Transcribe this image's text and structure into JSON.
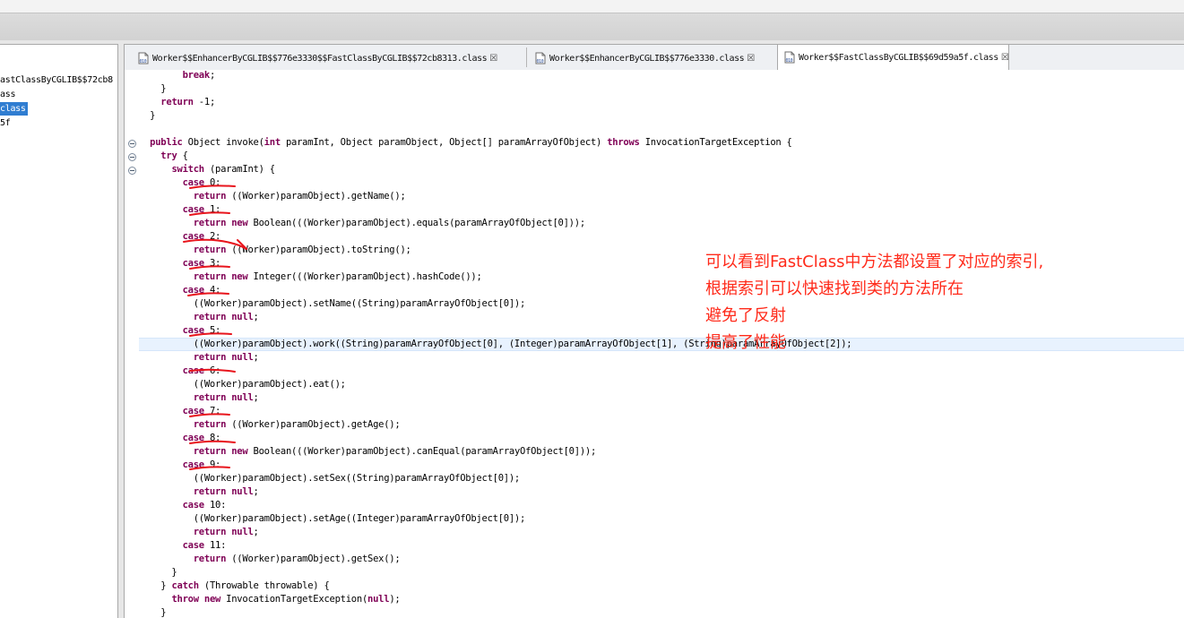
{
  "explorer": {
    "items": [
      {
        "label": "astClassByCGLIB$$72cb8",
        "selected": false
      },
      {
        "label": "ass",
        "selected": false
      },
      {
        "label": "class",
        "selected": true
      },
      {
        "label": "5f",
        "selected": false
      }
    ]
  },
  "editor_tabs": [
    {
      "label": "Worker$$EnhancerByCGLIB$$776e3330$$FastClassByCGLIB$$72cb8313.class",
      "close": "☒",
      "active": false
    },
    {
      "label": "Worker$$EnhancerByCGLIB$$776e3330.class",
      "close": "☒",
      "active": false
    },
    {
      "label": "Worker$$FastClassByCGLIB$$69d59a5f.class",
      "close": "☒",
      "active": true
    }
  ],
  "code_lines": [
    "        break;",
    "    }",
    "    return -1;",
    "  }",
    "",
    "  public Object invoke(int paramInt, Object paramObject, Object[] paramArrayOfObject) throws InvocationTargetException {",
    "    try {",
    "      switch (paramInt) {",
    "        case 0:",
    "          return ((Worker)paramObject).getName();",
    "        case 1:",
    "          return new Boolean(((Worker)paramObject).equals(paramArrayOfObject[0]));",
    "        case 2:",
    "          return ((Worker)paramObject).toString();",
    "        case 3:",
    "          return new Integer(((Worker)paramObject).hashCode());",
    "        case 4:",
    "          ((Worker)paramObject).setName((String)paramArrayOfObject[0]);",
    "          return null;",
    "        case 5:",
    "          ((Worker)paramObject).work((String)paramArrayOfObject[0], (Integer)paramArrayOfObject[1], (String)paramArrayOfObject[2]);",
    "          return null;",
    "        case 6:",
    "          ((Worker)paramObject).eat();",
    "          return null;",
    "        case 7:",
    "          return ((Worker)paramObject).getAge();",
    "        case 8:",
    "          return new Boolean(((Worker)paramObject).canEqual(paramArrayOfObject[0]));",
    "        case 9:",
    "          ((Worker)paramObject).setSex((String)paramArrayOfObject[0]);",
    "          return null;",
    "        case 10:",
    "          ((Worker)paramObject).setAge((Integer)paramArrayOfObject[0]);",
    "          return null;",
    "        case 11:",
    "          return ((Worker)paramObject).getSex();",
    "      }",
    "    } catch (Throwable throwable) {",
    "      throw new InvocationTargetException(null);",
    "    }"
  ],
  "highlighted_line_index": 20,
  "annotation": {
    "lines": [
      "可以看到FastClass中方法都设置了对应的索引,",
      "根据索引可以快速找到类的方法所在",
      "避免了反射",
      "提高了性能"
    ],
    "color": "#ff2a1a"
  },
  "colors": {
    "keyword": "#7f0055",
    "selection": "#2f7dd1",
    "current_line": "#e8f2fe",
    "pen": "#e8141c"
  },
  "icons": {
    "tab_icon": "class-file-icon",
    "fold": "collapse-icon"
  }
}
